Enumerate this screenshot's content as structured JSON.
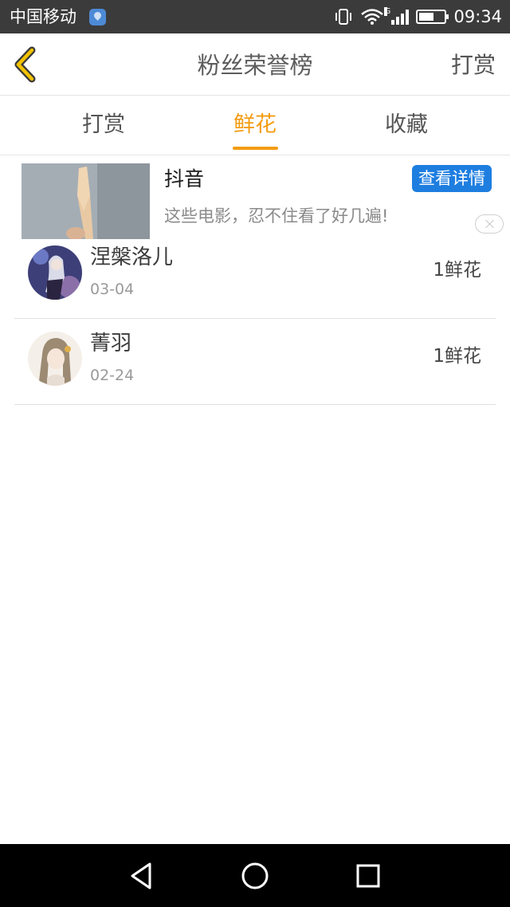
{
  "status_bar": {
    "carrier": "中国移动",
    "network_type": "G",
    "time": "09:34",
    "icons": [
      "location-icon",
      "vibrate-icon",
      "wifi-icon",
      "signal-icon",
      "battery-icon"
    ]
  },
  "header": {
    "back_icon": "chevron-left-icon",
    "title": "粉丝荣誉榜",
    "right_action": "打赏",
    "accent_color": "#f39c12"
  },
  "tabs": [
    {
      "label": "打赏",
      "active": false
    },
    {
      "label": "鲜花",
      "active": true
    },
    {
      "label": "收藏",
      "active": false
    }
  ],
  "ad": {
    "title": "抖音",
    "description": "这些电影，忍不住看了好几遍!",
    "button_label": "查看详情",
    "button_color": "#1e7ee0",
    "close_icon": "close-icon"
  },
  "list": [
    {
      "name": "涅槃洛儿",
      "date": "03-04",
      "count": "1鲜花"
    },
    {
      "name": "菁羽",
      "date": "02-24",
      "count": "1鲜花"
    }
  ],
  "nav_bar": {
    "icons": [
      "back-triangle-icon",
      "home-circle-icon",
      "recents-square-icon"
    ]
  }
}
